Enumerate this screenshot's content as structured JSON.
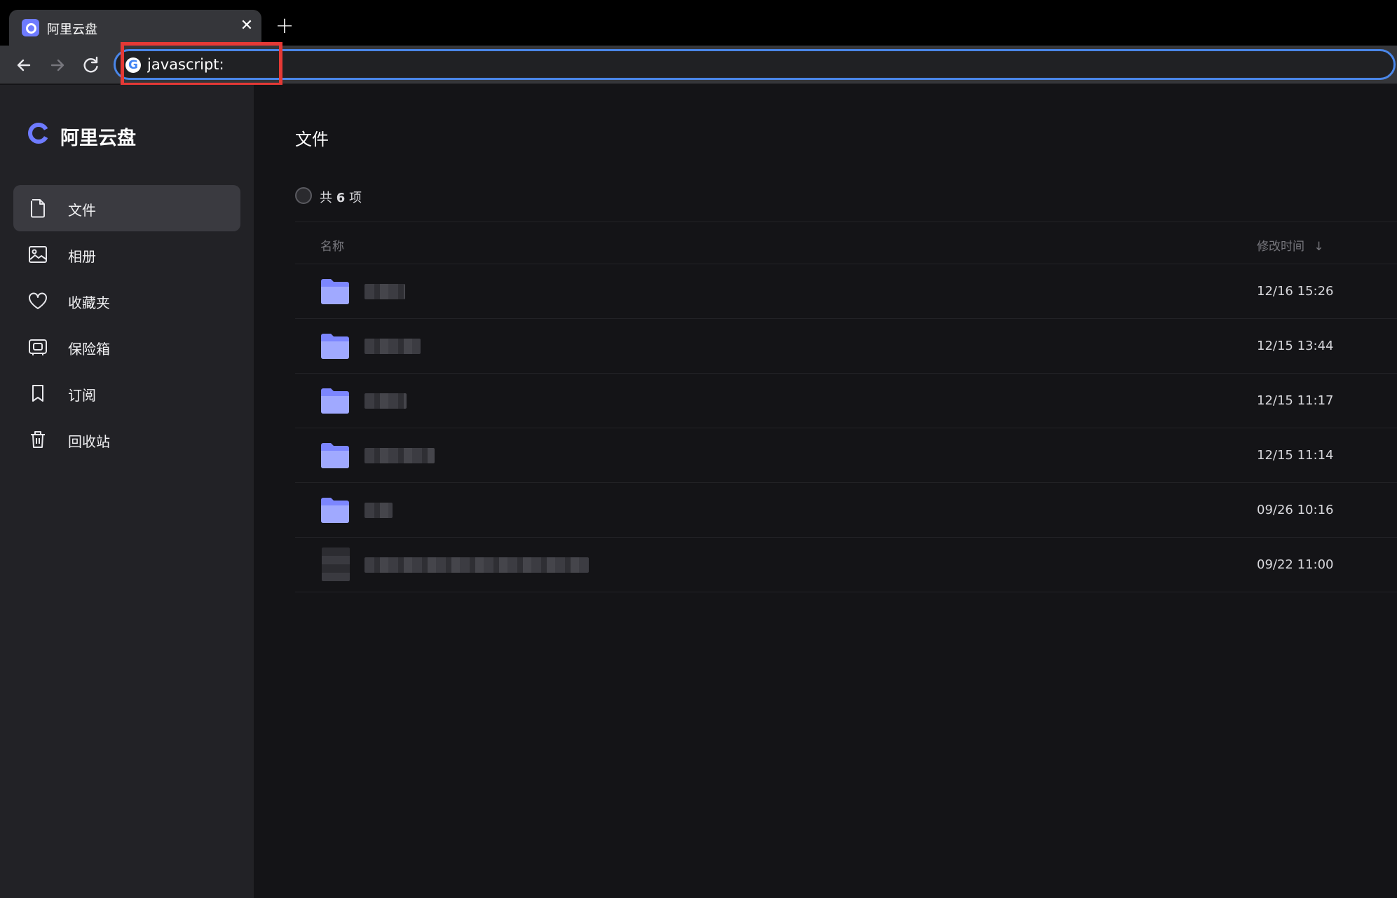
{
  "browser": {
    "tab_title": "阿里云盘",
    "tab_close": "✕",
    "new_tab": "+",
    "address": "javascript:",
    "colors": {
      "focus_ring": "#4a86e8",
      "highlight": "#e53935"
    }
  },
  "app": {
    "brand": "阿里云盘",
    "accent": "#6e7bff",
    "nav": [
      {
        "label": "文件",
        "icon": "file-icon",
        "active": true
      },
      {
        "label": "相册",
        "icon": "photo-album-icon"
      },
      {
        "label": "收藏夹",
        "icon": "heart-icon"
      },
      {
        "label": "保险箱",
        "icon": "safe-icon"
      },
      {
        "label": "订阅",
        "icon": "bookmark-icon"
      },
      {
        "label": "回收站",
        "icon": "trash-icon"
      }
    ],
    "page_title": "文件",
    "count_prefix": "共",
    "count": "6",
    "count_suffix": "项",
    "columns": {
      "name": "名称",
      "modified": "修改时间",
      "sort_indicator": "↓"
    },
    "rows": [
      {
        "type": "folder",
        "time": "12/16 15:26",
        "name_redacted": true
      },
      {
        "type": "folder",
        "time": "12/15 13:44",
        "name_redacted": true
      },
      {
        "type": "folder",
        "time": "12/15 11:17",
        "name_redacted": true
      },
      {
        "type": "folder",
        "time": "12/15 11:14",
        "name_redacted": true
      },
      {
        "type": "folder",
        "time": "09/26 10:16",
        "name_redacted": true
      },
      {
        "type": "file",
        "time": "09/22 11:00",
        "name_redacted": true
      }
    ]
  }
}
